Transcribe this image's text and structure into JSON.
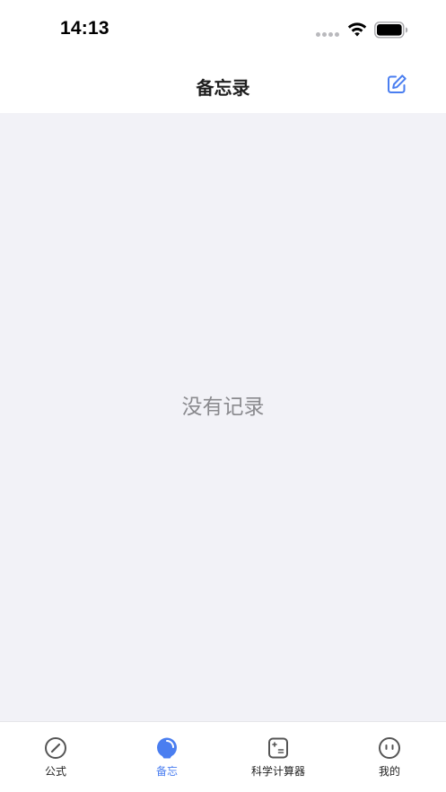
{
  "status_bar": {
    "time": "14:13"
  },
  "nav": {
    "title": "备忘录",
    "compose_icon": "compose-icon"
  },
  "content": {
    "empty_message": "没有记录"
  },
  "tab_bar": {
    "active_index": 1,
    "tabs": [
      {
        "label": "公式",
        "icon": "compass-icon"
      },
      {
        "label": "备忘",
        "icon": "memo-bulb-icon"
      },
      {
        "label": "科学计算器",
        "icon": "calculator-icon"
      },
      {
        "label": "我的",
        "icon": "profile-face-icon"
      }
    ]
  },
  "colors": {
    "accent": "#4a7ef0",
    "background": "#f2f2f7",
    "title_text": "#1f1f1f",
    "empty_text": "#8a8a8e"
  }
}
